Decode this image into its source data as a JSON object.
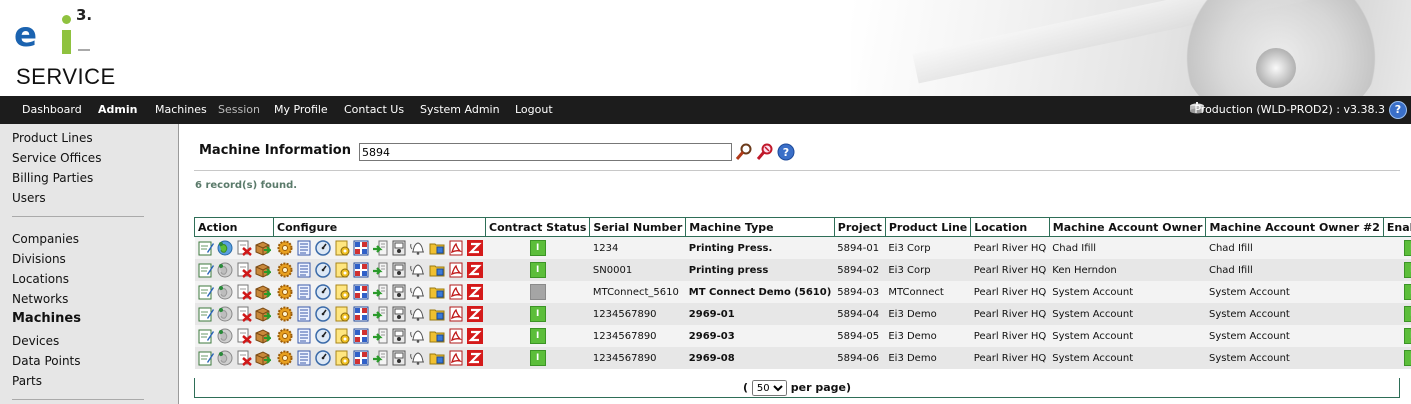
{
  "header": {
    "logo_e": "e",
    "logo_superscript": "3.",
    "title": "SERVICE"
  },
  "nav": {
    "items": [
      "Dashboard",
      "Admin",
      "Machines",
      "Session",
      "My Profile",
      "Contact Us",
      "System Admin",
      "Logout"
    ],
    "environment": "Production (WLD-PROD2) : v3.38.3",
    "help_label": "?"
  },
  "sidebar": {
    "group1": [
      "Product Lines",
      "Service Offices",
      "Billing Parties",
      "Users"
    ],
    "group2": [
      "Companies",
      "Divisions",
      "Locations",
      "Networks",
      "Machines",
      "Devices",
      "Data Points",
      "Parts"
    ]
  },
  "search": {
    "label": "Machine Information",
    "value": "5894"
  },
  "records_found": "6 record(s) found.",
  "table": {
    "headers": [
      "Action",
      "Configure",
      "Contract Status",
      "Serial Number",
      "Machine Type",
      "Project",
      "Product Line",
      "Location",
      "Machine Account Owner",
      "Machine Account Owner #2",
      "Enabled"
    ],
    "rows": [
      {
        "contract": "active",
        "serial": "1234",
        "type": "Printing Press.",
        "project": "5894-01",
        "product_line": "Ei3 Corp",
        "location": "Pearl River HQ",
        "owner": "Chad Ifill",
        "owner2": "Chad Ifill",
        "enabled": "active"
      },
      {
        "contract": "active",
        "serial": "SN0001",
        "type": "Printing press",
        "project": "5894-02",
        "product_line": "Ei3 Corp",
        "location": "Pearl River HQ",
        "owner": "Ken Herndon",
        "owner2": "Chad Ifill",
        "enabled": "active"
      },
      {
        "contract": "inactive",
        "serial": "MTConnect_5610",
        "type": "MT Connect Demo (5610)",
        "project": "5894-03",
        "product_line": "MTConnect",
        "location": "Pearl River HQ",
        "owner": "System Account",
        "owner2": "System Account",
        "enabled": "active"
      },
      {
        "contract": "active",
        "serial": "1234567890",
        "type": "2969-01",
        "project": "5894-04",
        "product_line": "Ei3 Demo",
        "location": "Pearl River HQ",
        "owner": "System Account",
        "owner2": "System Account",
        "enabled": "active"
      },
      {
        "contract": "active",
        "serial": "1234567890",
        "type": "2969-03",
        "project": "5894-05",
        "product_line": "Ei3 Demo",
        "location": "Pearl River HQ",
        "owner": "System Account",
        "owner2": "System Account",
        "enabled": "active"
      },
      {
        "contract": "active",
        "serial": "1234567890",
        "type": "2969-08",
        "project": "5894-06",
        "product_line": "Ei3 Demo",
        "location": "Pearl River HQ",
        "owner": "System Account",
        "owner2": "System Account",
        "enabled": "active"
      }
    ],
    "status_glyph": "I"
  },
  "pager": {
    "open": "(",
    "per_page_value": "50",
    "per_page_label": "per page)"
  },
  "icons": {
    "action": [
      "edit-icon",
      "globe-icon",
      "delete-icon",
      "move-icon"
    ],
    "configure": [
      "gear-icon",
      "list-icon",
      "gauge-icon",
      "document-icon",
      "grid-icon",
      "import-icon",
      "device-icon",
      "alarm-bell-icon",
      "folder-icon",
      "pdf-icon",
      "z-icon"
    ]
  },
  "colors": {
    "nav_bg": "#1c1c1c",
    "header_border": "#2e6e57",
    "status_active": "#5cbe3a",
    "status_inactive": "#a5a5a5",
    "brand_blue": "#1b63b0",
    "brand_green": "#8fc23f"
  }
}
